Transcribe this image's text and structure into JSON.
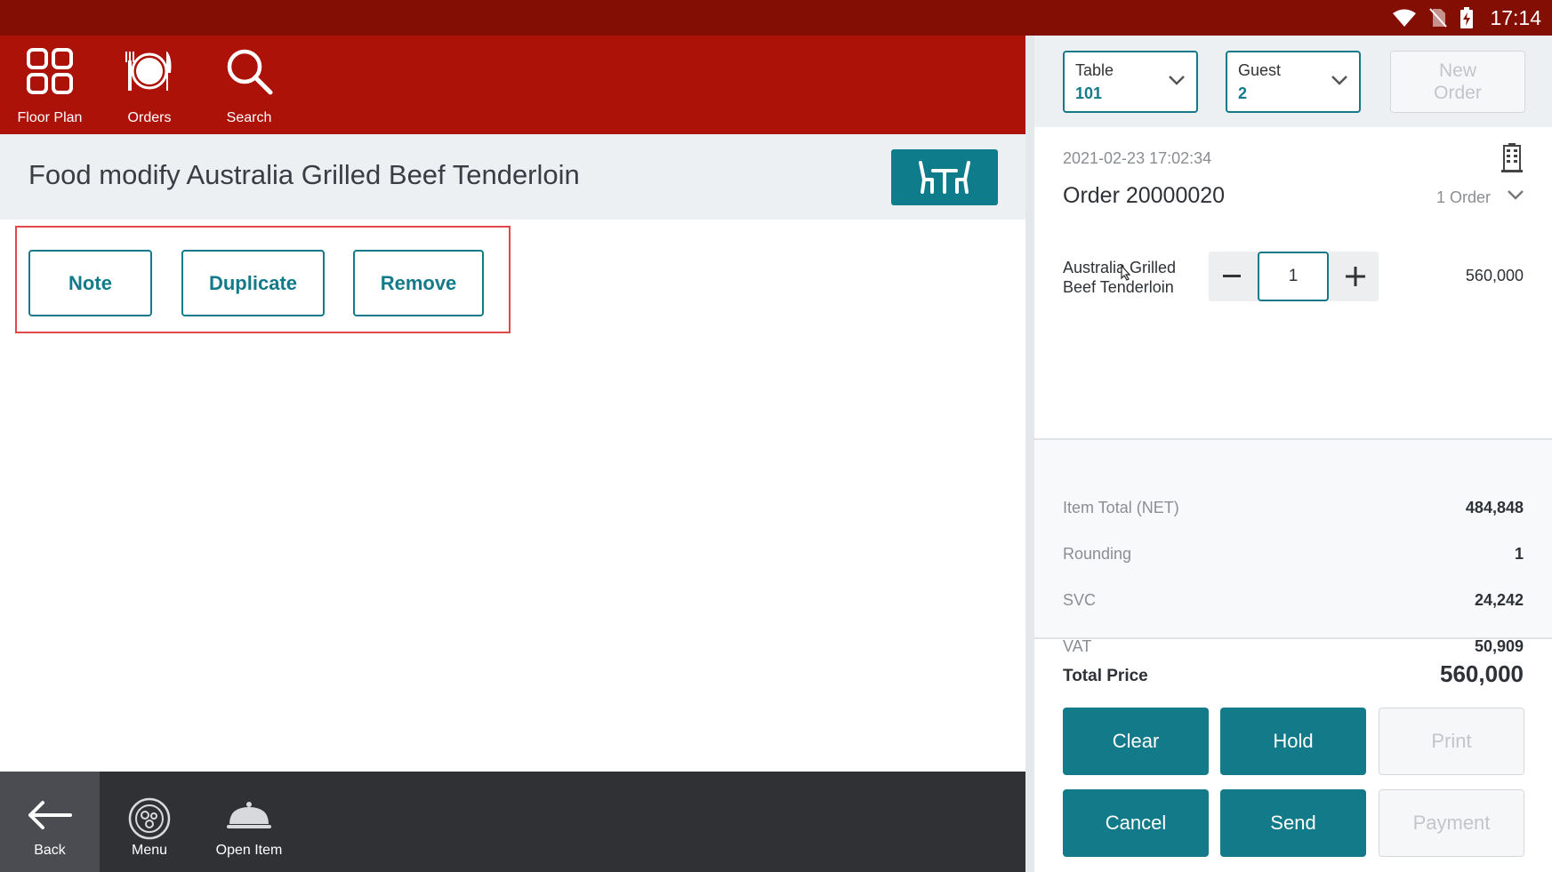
{
  "status_bar": {
    "time": "17:14"
  },
  "nav": [
    {
      "label": "Floor Plan",
      "icon": "floor-plan-icon"
    },
    {
      "label": "Orders",
      "icon": "orders-icon"
    },
    {
      "label": "Search",
      "icon": "search-icon"
    }
  ],
  "page": {
    "title": "Food modify Australia Grilled Beef Tenderloin"
  },
  "actions": {
    "note": "Note",
    "duplicate": "Duplicate",
    "remove": "Remove"
  },
  "bottom_nav": {
    "back": "Back",
    "menu": "Menu",
    "open_item": "Open Item"
  },
  "order_header": {
    "table_label": "Table",
    "table_value": "101",
    "guest_label": "Guest",
    "guest_value": "2",
    "new_order_line1": "New",
    "new_order_line2": "Order"
  },
  "order": {
    "datetime": "2021-02-23 17:02:34",
    "number": "Order 20000020",
    "count": "1 Order",
    "items": [
      {
        "name_line1": "Australia Grilled",
        "name_line2": "Beef Tenderloin",
        "qty": "1",
        "price": "560,000"
      }
    ]
  },
  "summary": [
    {
      "label": "Item Total (NET)",
      "value": "484,848"
    },
    {
      "label": "Rounding",
      "value": "1"
    },
    {
      "label": "SVC",
      "value": "24,242"
    },
    {
      "label": "VAT",
      "value": "50,909"
    }
  ],
  "total": {
    "label": "Total Price",
    "value": "560,000"
  },
  "buttons": {
    "clear": "Clear",
    "hold": "Hold",
    "print": "Print",
    "cancel": "Cancel",
    "send": "Send",
    "payment": "Payment"
  },
  "colors": {
    "status_bar": "#820e04",
    "header": "#ad1208",
    "accent": "#127a89",
    "bottom_bar": "#2f3135"
  }
}
